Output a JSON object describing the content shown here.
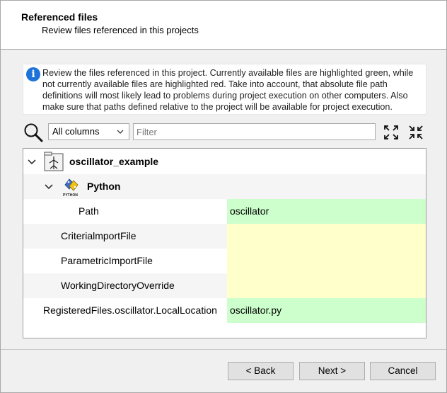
{
  "header": {
    "title": "Referenced files",
    "subtitle": "Review files referenced in this projects"
  },
  "info": {
    "text": "Review the files referenced in this project. Currently available files are highlighted green, while not currently available files are highlighted red. Take into account, that absolute file path definitions will most likely lead to problems during project execution on other computers. Also make sure that paths defined relative to the project will be available for project execution."
  },
  "toolbar": {
    "column_selected": "All columns",
    "filter_placeholder": "Filter",
    "expand_icon": "expand-all-icon",
    "collapse_icon": "collapse-all-icon"
  },
  "tree": {
    "project": {
      "label": "oscillator_example",
      "icon": "project-tree-icon"
    },
    "group": {
      "label": "Python",
      "icon": "python-icon",
      "icon_caption": "PYTHON"
    },
    "rows": [
      {
        "key": "Path",
        "value": "oscillator",
        "status": "green"
      },
      {
        "key": "CriterialmportFile",
        "value": "",
        "status": "yellow"
      },
      {
        "key": "ParametricImportFile",
        "value": "",
        "status": "yellow"
      },
      {
        "key": "WorkingDirectoryOverride",
        "value": "",
        "status": "yellow"
      },
      {
        "key": "RegisteredFiles.oscillator.LocalLocation",
        "value": "oscillator.py",
        "status": "green"
      }
    ]
  },
  "colors": {
    "available": "#ccffcc",
    "unset": "#ffffcc",
    "info_blue": "#1e73d8"
  },
  "buttons": {
    "back": "< Back",
    "next": "Next >",
    "cancel": "Cancel"
  }
}
